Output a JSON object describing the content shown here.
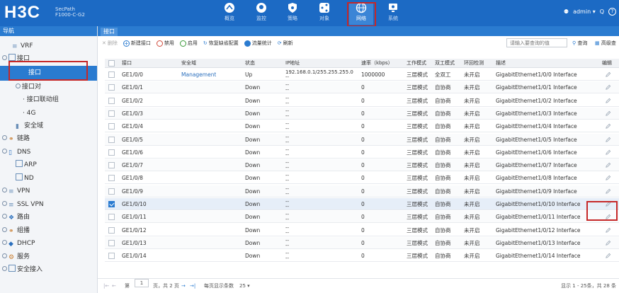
{
  "brand": {
    "logo": "H3C",
    "product_line1": "SecPath",
    "product_line2": "F1000-C-G2"
  },
  "nav": [
    {
      "label": "概览",
      "icon": "overview-icon"
    },
    {
      "label": "监控",
      "icon": "monitor-icon"
    },
    {
      "label": "策略",
      "icon": "policy-icon"
    },
    {
      "label": "对象",
      "icon": "object-icon"
    },
    {
      "label": "网络",
      "icon": "network-icon",
      "active": true
    },
    {
      "label": "系统",
      "icon": "system-icon"
    }
  ],
  "user": {
    "name": "admin ▾",
    "search_glyph": "Q",
    "help_glyph": "?"
  },
  "sidebar": {
    "header": "导航",
    "items": [
      {
        "label": "VRF"
      },
      {
        "label": "接口"
      },
      {
        "label": "接口",
        "selected": true
      },
      {
        "label": "接口对"
      },
      {
        "label": "· 接口联动组"
      },
      {
        "label": "· 4G"
      },
      {
        "label": "安全域"
      },
      {
        "label": "链路"
      },
      {
        "label": "DNS"
      },
      {
        "label": "ARP"
      },
      {
        "label": "ND"
      },
      {
        "label": "VPN"
      },
      {
        "label": "SSL VPN"
      },
      {
        "label": "路由"
      },
      {
        "label": "组播"
      },
      {
        "label": "DHCP"
      },
      {
        "label": "服务"
      },
      {
        "label": "安全接入"
      }
    ]
  },
  "tab": {
    "label": "接口"
  },
  "toolbar": {
    "delete": "删除",
    "new": "新建接口",
    "disable": "禁用",
    "enable": "启用",
    "restore": "恢复缺省配置",
    "traffic": "流量统计",
    "refresh": "刷新",
    "search_placeholder": "请输入要查询的值",
    "query": "查询",
    "advanced": "高级查"
  },
  "table": {
    "headers": [
      "接口",
      "安全域",
      "状态",
      "IP地址",
      "速率（kbps）",
      "工作模式",
      "双工模式",
      "环回检测",
      "描述",
      "编辑"
    ],
    "rows": [
      {
        "iface": "GE1/0/0",
        "zone": "Management",
        "status": "Up",
        "ip": "192.168.0.1/255.255.255.0",
        "ip2": "--",
        "rate": "1000000",
        "mode": "三层模式",
        "duplex": "全双工",
        "loop": "未开启",
        "desc": "GigabitEthernet1/0/0 Interface"
      },
      {
        "iface": "GE1/0/1",
        "zone": "",
        "status": "Down",
        "ip": "--",
        "ip2": "--",
        "rate": "0",
        "mode": "三层模式",
        "duplex": "自协商",
        "loop": "未开启",
        "desc": "GigabitEthernet1/0/1 Interface"
      },
      {
        "iface": "GE1/0/2",
        "zone": "",
        "status": "Down",
        "ip": "--",
        "ip2": "--",
        "rate": "0",
        "mode": "三层模式",
        "duplex": "自协商",
        "loop": "未开启",
        "desc": "GigabitEthernet1/0/2 Interface"
      },
      {
        "iface": "GE1/0/3",
        "zone": "",
        "status": "Down",
        "ip": "--",
        "ip2": "--",
        "rate": "0",
        "mode": "三层模式",
        "duplex": "自协商",
        "loop": "未开启",
        "desc": "GigabitEthernet1/0/3 Interface"
      },
      {
        "iface": "GE1/0/4",
        "zone": "",
        "status": "Down",
        "ip": "--",
        "ip2": "--",
        "rate": "0",
        "mode": "三层模式",
        "duplex": "自协商",
        "loop": "未开启",
        "desc": "GigabitEthernet1/0/4 Interface"
      },
      {
        "iface": "GE1/0/5",
        "zone": "",
        "status": "Down",
        "ip": "--",
        "ip2": "--",
        "rate": "0",
        "mode": "三层模式",
        "duplex": "自协商",
        "loop": "未开启",
        "desc": "GigabitEthernet1/0/5 Interface"
      },
      {
        "iface": "GE1/0/6",
        "zone": "",
        "status": "Down",
        "ip": "--",
        "ip2": "--",
        "rate": "0",
        "mode": "三层模式",
        "duplex": "自协商",
        "loop": "未开启",
        "desc": "GigabitEthernet1/0/6 Interface"
      },
      {
        "iface": "GE1/0/7",
        "zone": "",
        "status": "Down",
        "ip": "--",
        "ip2": "--",
        "rate": "0",
        "mode": "三层模式",
        "duplex": "自协商",
        "loop": "未开启",
        "desc": "GigabitEthernet1/0/7 Interface"
      },
      {
        "iface": "GE1/0/8",
        "zone": "",
        "status": "Down",
        "ip": "--",
        "ip2": "--",
        "rate": "0",
        "mode": "三层模式",
        "duplex": "自协商",
        "loop": "未开启",
        "desc": "GigabitEthernet1/0/8 Interface"
      },
      {
        "iface": "GE1/0/9",
        "zone": "",
        "status": "Down",
        "ip": "--",
        "ip2": "--",
        "rate": "0",
        "mode": "三层模式",
        "duplex": "自协商",
        "loop": "未开启",
        "desc": "GigabitEthernet1/0/9 Interface"
      },
      {
        "iface": "GE1/0/10",
        "zone": "",
        "status": "Down",
        "ip": "--",
        "ip2": "--",
        "rate": "0",
        "mode": "三层模式",
        "duplex": "自协商",
        "loop": "未开启",
        "desc": "GigabitEthernet1/0/10 Interface",
        "checked": true
      },
      {
        "iface": "GE1/0/11",
        "zone": "",
        "status": "Down",
        "ip": "--",
        "ip2": "--",
        "rate": "0",
        "mode": "三层模式",
        "duplex": "自协商",
        "loop": "未开启",
        "desc": "GigabitEthernet1/0/11 Interface"
      },
      {
        "iface": "GE1/0/12",
        "zone": "",
        "status": "Down",
        "ip": "--",
        "ip2": "--",
        "rate": "0",
        "mode": "三层模式",
        "duplex": "自协商",
        "loop": "未开启",
        "desc": "GigabitEthernet1/0/12 Interface"
      },
      {
        "iface": "GE1/0/13",
        "zone": "",
        "status": "Down",
        "ip": "--",
        "ip2": "--",
        "rate": "0",
        "mode": "三层模式",
        "duplex": "自协商",
        "loop": "未开启",
        "desc": "GigabitEthernet1/0/13 Interface"
      },
      {
        "iface": "GE1/0/14",
        "zone": "",
        "status": "Down",
        "ip": "--",
        "ip2": "--",
        "rate": "0",
        "mode": "三层模式",
        "duplex": "自协商",
        "loop": "未开启",
        "desc": "GigabitEthernet1/0/14 Interface"
      }
    ]
  },
  "footer": {
    "page_prefix": "第",
    "page_value": "1",
    "page_suffix": "页，共 2 页",
    "per_page_label": "每页显示条数",
    "per_page_value": "25 ▾",
    "summary": "显示 1 - 25条，共 28 条"
  },
  "colors": {
    "brand": "#1c6ac4",
    "selected": "#2a7bd0",
    "highlight": "#c62828"
  }
}
